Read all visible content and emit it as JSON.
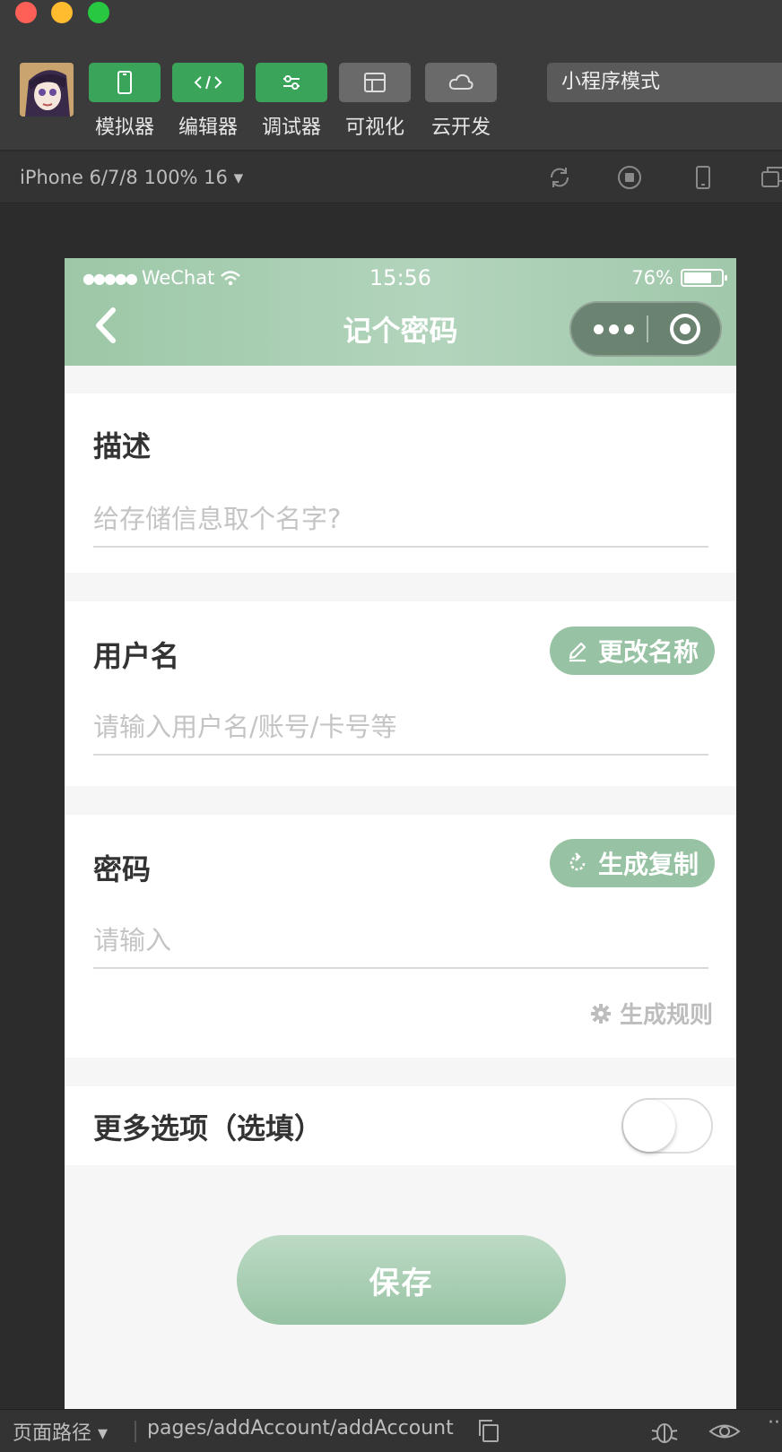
{
  "toolbar": {
    "tools": [
      {
        "label": "模拟器",
        "icon": "phone-icon",
        "active": true
      },
      {
        "label": "编辑器",
        "icon": "code-icon",
        "active": true
      },
      {
        "label": "调试器",
        "icon": "sliders-icon",
        "active": true
      },
      {
        "label": "可视化",
        "icon": "layout-icon",
        "active": false
      },
      {
        "label": "云开发",
        "icon": "cloud-icon",
        "active": false
      }
    ],
    "mode": "小程序模式"
  },
  "device_bar": {
    "device": "iPhone 6/7/8 100% 16 ▾"
  },
  "phone": {
    "status": {
      "carrier": "WeChat",
      "time": "15:56",
      "battery": "76%",
      "battery_level": 0.76
    },
    "nav_title": "记个密码",
    "description": {
      "label": "描述",
      "placeholder": "给存储信息取个名字?"
    },
    "username": {
      "label": "用户名",
      "action": "更改名称",
      "placeholder": "请输入用户名/账号/卡号等"
    },
    "password": {
      "label": "密码",
      "action": "生成复制",
      "placeholder": "请输入",
      "rule_link": "生成规则"
    },
    "more_options": {
      "label": "更多选项（选填）",
      "enabled": false
    },
    "save_label": "保存"
  },
  "bottom_bar": {
    "path_label": "页面路径 ▾",
    "path_value": "pages/addAccount/addAccount"
  },
  "colors": {
    "accent_green": "#97c2a3",
    "toolbar_active": "#3aa55a"
  }
}
